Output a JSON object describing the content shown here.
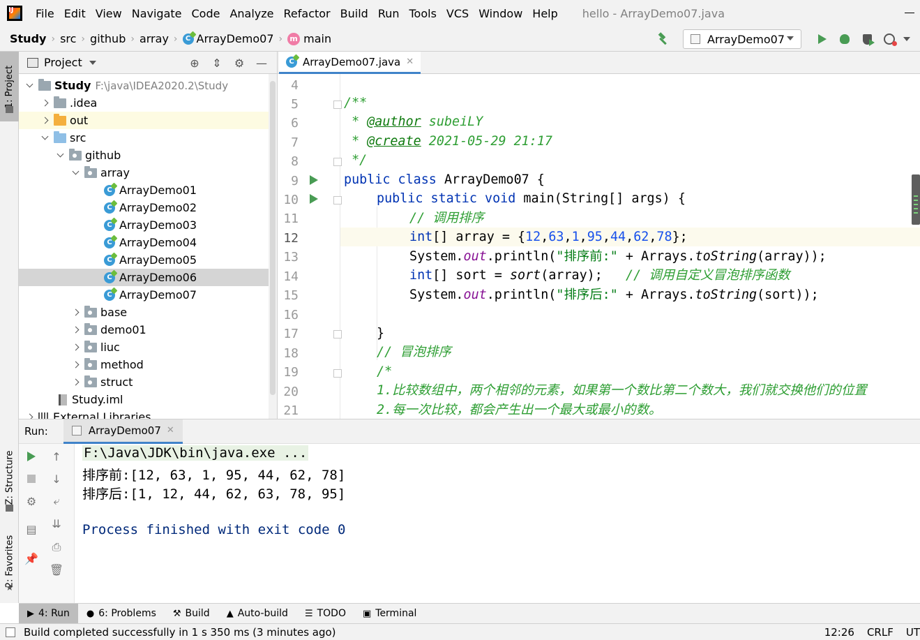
{
  "menubar": {
    "items": [
      "File",
      "Edit",
      "View",
      "Navigate",
      "Code",
      "Analyze",
      "Refactor",
      "Build",
      "Run",
      "Tools",
      "VCS",
      "Window",
      "Help"
    ],
    "window_title": "hello - ArrayDemo07.java"
  },
  "breadcrumb": {
    "items": [
      "Study",
      "src",
      "github",
      "array",
      "ArrayDemo07",
      "main"
    ]
  },
  "run_config": {
    "label": "ArrayDemo07"
  },
  "left_stripe": {
    "project": "1: Project",
    "structure": "Z: Structure",
    "favorites": "2: Favorites"
  },
  "project_panel": {
    "title": "Project",
    "tree": [
      {
        "label": "Study",
        "path": "F:\\java\\IDEA2020.2\\Study"
      },
      {
        "label": ".idea"
      },
      {
        "label": "out"
      },
      {
        "label": "src"
      },
      {
        "label": "github"
      },
      {
        "label": "array"
      },
      {
        "label": "ArrayDemo01"
      },
      {
        "label": "ArrayDemo02"
      },
      {
        "label": "ArrayDemo03"
      },
      {
        "label": "ArrayDemo04"
      },
      {
        "label": "ArrayDemo05"
      },
      {
        "label": "ArrayDemo06"
      },
      {
        "label": "ArrayDemo07"
      },
      {
        "label": "base"
      },
      {
        "label": "demo01"
      },
      {
        "label": "liuc"
      },
      {
        "label": "method"
      },
      {
        "label": "struct"
      },
      {
        "label": "Study.iml"
      },
      {
        "label": "External Libraries"
      }
    ]
  },
  "editor": {
    "tab": "ArrayDemo07.java",
    "line_numbers": [
      "4",
      "5",
      "6",
      "7",
      "8",
      "9",
      "10",
      "11",
      "12",
      "13",
      "14",
      "15",
      "16",
      "17",
      "18",
      "19",
      "20",
      "21"
    ],
    "code": {
      "l5": "/**",
      "l6_star": " * ",
      "l6_tag": "@author",
      "l6_val": " subeiLY",
      "l7_star": " * ",
      "l7_tag": "@create",
      "l7_val": " 2021-05-29 21:17",
      "l8": " */",
      "l9_kw": "public class",
      "l9_rest": " ArrayDemo07 {",
      "l10_kw": "public static void",
      "l10_rest": " main(String[] args) {",
      "l11": "// 调用排序",
      "l12_kw": "int",
      "l12_a": "[] array = {",
      "l12_n1": "12",
      "l12_n2": "63",
      "l12_n3": "1",
      "l12_n4": "95",
      "l12_n5": "44",
      "l12_n6": "62",
      "l12_n7": "78",
      "l12_end": "};",
      "sys": "System.",
      "out": "out",
      "println": ".println(",
      "l13_str": "\"排序前:\"",
      "l13_rest": " + Arrays.",
      "tostring": "toString",
      "l13_end": "(array));",
      "l14_kw": "int",
      "l14_a": "[] sort = ",
      "l14_call": "sort",
      "l14_b": "(array);   ",
      "l14_cm": "// 调用自定义冒泡排序函数",
      "l15_str": "\"排序后:\"",
      "l15_rest": " + Arrays.",
      "l15_end": "(sort));",
      "l17": "}",
      "l18": "// 冒泡排序",
      "l19": "/*",
      "l20": "1.比较数组中，两个相邻的元素，如果第一个数比第二个数大，我们就交换他们的位置",
      "l21": "2.每一次比较，都会产生出一个最大或最小的数。"
    }
  },
  "run_panel": {
    "label": "Run:",
    "tab": "ArrayDemo07",
    "console": {
      "cmd": "F:\\Java\\JDK\\bin\\java.exe ...",
      "before": "排序前:[12, 63, 1, 95, 44, 62, 78]",
      "after": "排序后:[1, 12, 44, 62, 63, 78, 95]",
      "finish": "Process finished with exit code 0"
    }
  },
  "bottom_tabs": [
    "4: Run",
    "6: Problems",
    "Build",
    "Auto-build",
    "TODO",
    "Terminal"
  ],
  "status_bar": {
    "message": "Build completed successfully in 1 s 350 ms (3 minutes ago)",
    "time": "12:26",
    "line_sep": "CRLF",
    "encoding": "UT"
  }
}
